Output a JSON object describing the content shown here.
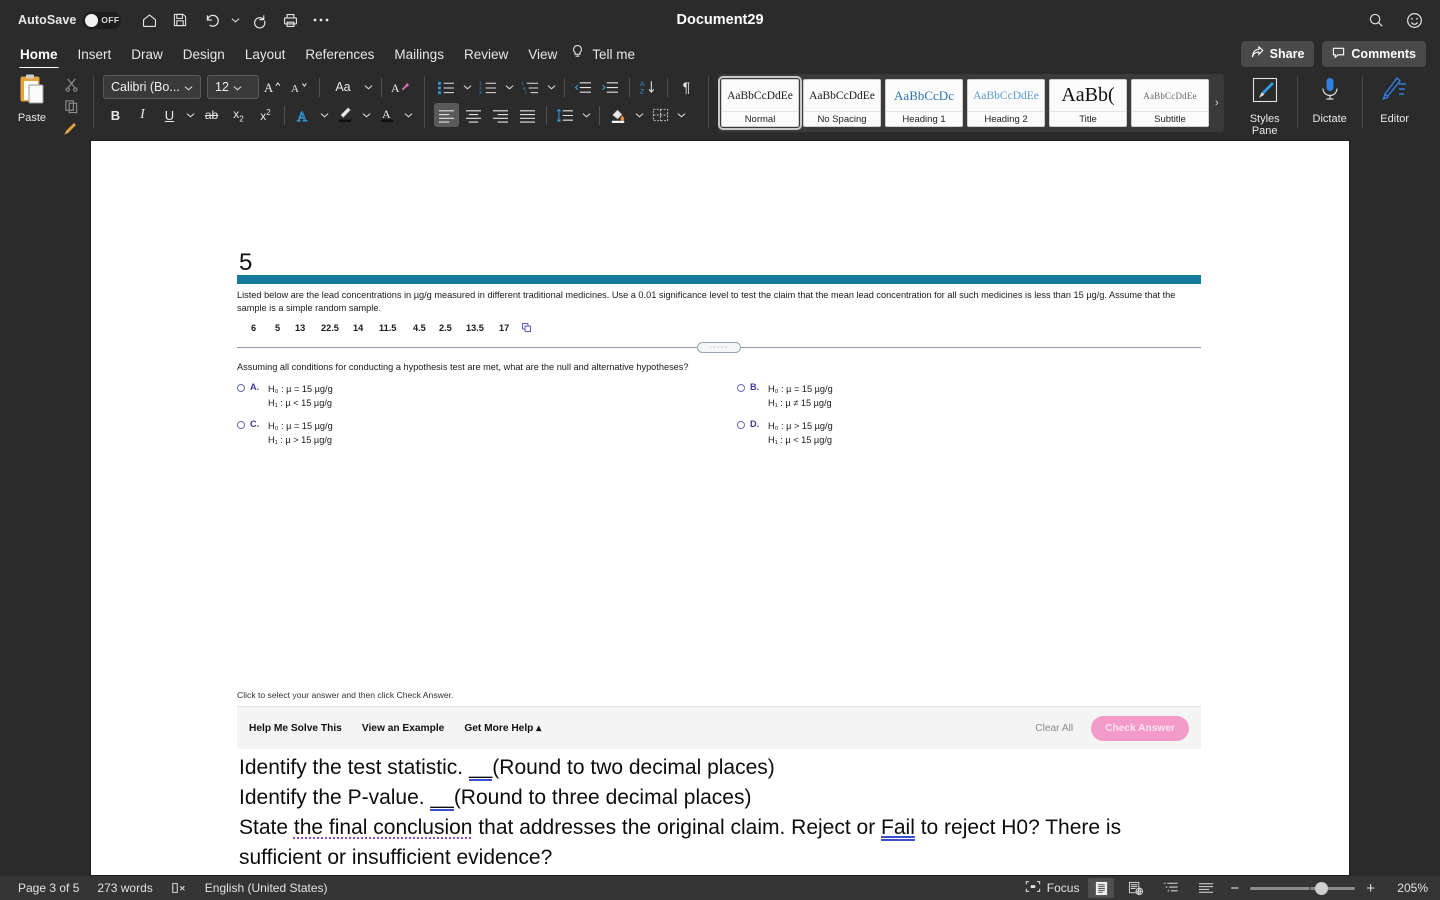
{
  "titlebar": {
    "autosave_label": "AutoSave",
    "autosave_state": "OFF",
    "document_title": "Document29",
    "icons": [
      "home-icon",
      "save-icon",
      "undo-icon",
      "undo-caret-icon",
      "redo-icon",
      "print-icon",
      "more-commands-icon"
    ],
    "right_icons": [
      "search-icon",
      "feedback-smiley-icon"
    ]
  },
  "ribbon_tabs": {
    "items": [
      {
        "label": "Home",
        "active": true
      },
      {
        "label": "Insert",
        "active": false
      },
      {
        "label": "Draw",
        "active": false
      },
      {
        "label": "Design",
        "active": false
      },
      {
        "label": "Layout",
        "active": false
      },
      {
        "label": "References",
        "active": false
      },
      {
        "label": "Mailings",
        "active": false
      },
      {
        "label": "Review",
        "active": false
      },
      {
        "label": "View",
        "active": false
      }
    ],
    "tell_me": "Tell me",
    "share": "Share",
    "comments": "Comments"
  },
  "ribbon": {
    "paste_label": "Paste",
    "font_name": "Calibri (Bo...",
    "font_size": "12",
    "case_label": "Aa",
    "styles": [
      {
        "preview": "AaBbCcDdEe",
        "name": "Normal",
        "selected": true
      },
      {
        "preview": "AaBbCcDdEe",
        "name": "No Spacing",
        "selected": false
      },
      {
        "preview": "AaBbCcDc",
        "name": "Heading 1",
        "selected": false
      },
      {
        "preview": "AaBbCcDdEe",
        "name": "Heading 2",
        "selected": false
      },
      {
        "preview": "AaBb(",
        "name": "Title",
        "selected": false
      },
      {
        "preview": "AaBbCcDdEe",
        "name": "Subtitle",
        "selected": false
      }
    ],
    "styles_pane": "Styles\nPane",
    "styles_pane_l1": "Styles",
    "styles_pane_l2": "Pane",
    "dictate": "Dictate",
    "editor": "Editor"
  },
  "document": {
    "question_number": "5",
    "accent_color": "#147a9c",
    "prompt_paragraph": "Listed below are the lead concentrations in µg/g measured in different traditional medicines. Use a 0.01 significance level to test the claim that the mean lead concentration for all such medicines is less than 15 µg/g. Assume that the sample is a simple random sample.",
    "data_values": [
      "6",
      "5",
      "13",
      "22.5",
      "14",
      "11.5",
      "4.5",
      "2.5",
      "13.5",
      "17"
    ],
    "copy_icon": "copy-data-icon",
    "question_prompt": "Assuming all conditions for conducting a hypothesis test are met, what are the null and alternative hypotheses?",
    "choices": [
      {
        "letter": "A.",
        "h0": "H₀ : µ = 15 µg/g",
        "h1": "H₁ : µ < 15 µg/g"
      },
      {
        "letter": "B.",
        "h0": "H₀ : µ = 15 µg/g",
        "h1": "H₁ : µ ≠ 15 µg/g"
      },
      {
        "letter": "C.",
        "h0": "H₀ : µ = 15 µg/g",
        "h1": "H₁ : µ > 15 µg/g"
      },
      {
        "letter": "D.",
        "h0": "H₀ : µ > 15 µg/g",
        "h1": "H₁ : µ < 15 µg/g"
      }
    ],
    "hint": "Click to select your answer and then click Check Answer.",
    "action_buttons": [
      "Help Me Solve This",
      "View an Example",
      "Get More Help ▴"
    ],
    "clear_all": "Clear All",
    "check_answer": "Check Answer",
    "check_answer_color": "#f49ac8",
    "typed_lines": {
      "l1_a": "Identify the test statistic. ",
      "l1_blank": "__",
      "l1_b": "(Round to two decimal places)",
      "l2_a": "Identify the P-value. ",
      "l2_blank": "__",
      "l2_b": "(Round to three decimal places)",
      "l3_a": "State ",
      "l3_grammar": "the final conclusion",
      "l3_b": " that addresses the original claim. Reject or ",
      "l3_spell": "Fail",
      "l3_c": " to reject H0? There is",
      "l4": "sufficient or insufficient evidence?"
    }
  },
  "status": {
    "page": "Page 3 of 5",
    "words": "273 words",
    "proofing_icon": "proofing-errors-icon",
    "language": "English (United States)",
    "focus": "Focus",
    "view_icons": [
      "print-layout-icon",
      "web-layout-icon",
      "outline-icon",
      "draft-icon"
    ],
    "zoom_out": "−",
    "zoom_in": "+",
    "zoom_level": "205%"
  }
}
